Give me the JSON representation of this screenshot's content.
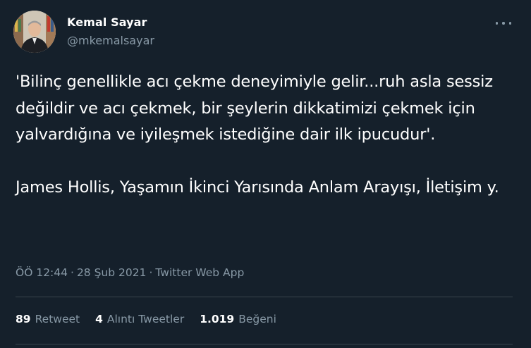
{
  "user": {
    "name": "Kemal Sayar",
    "handle": "@mkemalsayar"
  },
  "tweet": {
    "text": "'Bilinç genellikle acı çekme deneyimiyle gelir...ruh asla sessiz değildir ve acı çekmek, bir şeylerin dikkatimizi çekmek için yalvardığına ve iyileşmek istediğine dair ilk ipucudur'.\n\nJames Hollis, Yaşamın İkinci Yarısında Anlam Arayışı, İletişim y.",
    "time": "ÖÖ 12:44",
    "date": "28 Şub 2021",
    "source": "Twitter Web App",
    "separator": "·"
  },
  "stats": {
    "retweets": {
      "count": "89",
      "label": "Retweet"
    },
    "quotes": {
      "count": "4",
      "label": "Alıntı Tweetler"
    },
    "likes": {
      "count": "1.019",
      "label": "Beğeni"
    }
  },
  "icons": {
    "more": "more-horizontal-icon"
  },
  "colors": {
    "background": "#15202b",
    "primary_text": "#ffffff",
    "secondary_text": "#8899a6",
    "divider": "#38444d"
  }
}
